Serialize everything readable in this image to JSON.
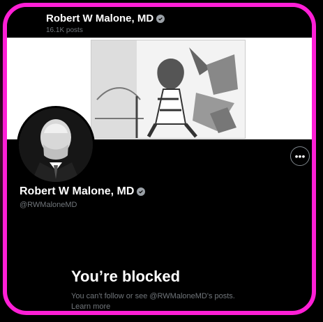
{
  "header": {
    "name": "Robert W Malone, MD",
    "posts": "16.1K posts"
  },
  "profile": {
    "name": "Robert W Malone, MD",
    "handle": "@RWMaloneMD"
  },
  "blocked": {
    "title": "You’re blocked",
    "message": "You can't follow or see @RWMaloneMD's posts.",
    "link": "Learn more"
  },
  "icons": {
    "verified": "verified-badge-icon",
    "more": "more-options-icon"
  },
  "colors": {
    "frame": "#ff1fd6",
    "background": "#000000",
    "secondary_text": "#71767b"
  }
}
